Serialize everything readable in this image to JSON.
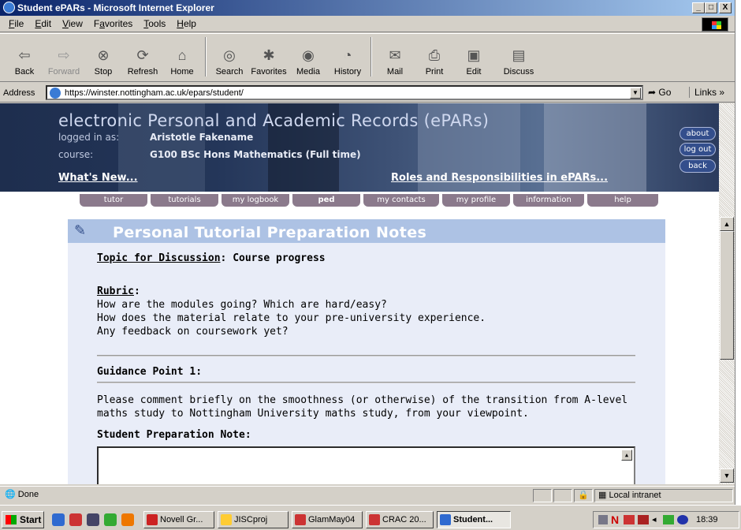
{
  "window": {
    "title": "Student ePARs - Microsoft Internet Explorer",
    "minimize": "_",
    "maximize": "□",
    "close": "X"
  },
  "menu": [
    {
      "key": "F",
      "rest": "ile"
    },
    {
      "key": "E",
      "rest": "dit"
    },
    {
      "key": "V",
      "rest": "iew"
    },
    {
      "pre": "F",
      "key": "a",
      "rest": "vorites"
    },
    {
      "key": "T",
      "rest": "ools"
    },
    {
      "key": "H",
      "rest": "elp"
    }
  ],
  "toolbar": {
    "back": "Back",
    "forward": "Forward",
    "stop": "Stop",
    "refresh": "Refresh",
    "home": "Home",
    "search": "Search",
    "favorites": "Favorites",
    "media": "Media",
    "history": "History",
    "mail": "Mail",
    "print": "Print",
    "edit": "Edit",
    "discuss": "Discuss"
  },
  "address": {
    "label": "Address",
    "url": "https://winster.nottingham.ac.uk/epars/student/",
    "go": "Go",
    "links": "Links »"
  },
  "banner": {
    "title": "electronic Personal and Academic Records (ePARs)",
    "logged_label": "logged in as:",
    "user": "Aristotle Fakename",
    "course_label": "course:",
    "course": "G100 BSc Hons Mathematics (Full time)",
    "whats_new": "What's New...",
    "roles": "Roles and Responsibilities in ePARs...",
    "about": "about",
    "logout": "log out",
    "back": "back"
  },
  "tabs": [
    "tutor",
    "tutorials",
    "my logbook",
    "ped",
    "my contacts",
    "my profile",
    "information",
    "help"
  ],
  "page": {
    "title": "Personal Tutorial Preparation Notes",
    "topic_label": "Topic for Discussion",
    "topic_value": ": Course progress",
    "rubric_label": "Rubric",
    "rubric_colon": ":",
    "rubric_lines": [
      "How are the modules going? Which are hard/easy?",
      "How does the material relate to your pre-university experience.",
      "Any feedback on coursework yet?"
    ],
    "guidance_title": "Guidance Point 1:",
    "guidance_lines": [
      "Please comment briefly on the smoothness (or otherwise) of the transition from A-level",
      "maths study to Nottingham University maths study, from your viewpoint."
    ],
    "note_label": "Student Preparation Note:"
  },
  "status": {
    "text": "Done",
    "zone": "Local intranet"
  },
  "taskbar": {
    "start": "Start",
    "items": [
      "Novell Gr...",
      "JISCproj",
      "GlamMay04",
      "CRAC 20...",
      "Student..."
    ],
    "clock": "18:39"
  }
}
